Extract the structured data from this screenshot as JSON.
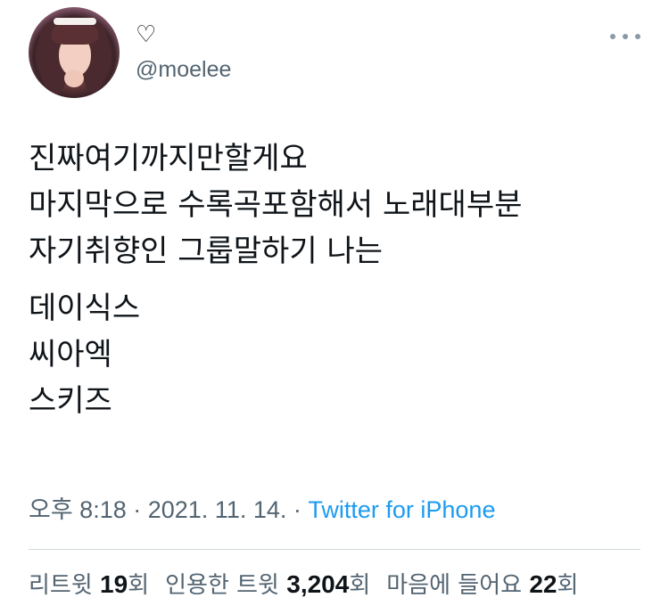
{
  "user": {
    "display_name": "♡",
    "handle": "@moelee"
  },
  "tweet": {
    "paragraphs": [
      [
        "진짜여기까지만할게요",
        "마지막으로 수록곡포함해서 노래대부분",
        "자기취향인 그룹말하기 나는"
      ],
      [
        "데이식스",
        "씨아엑",
        "스키즈"
      ]
    ]
  },
  "meta": {
    "time": "오후 8:18",
    "sep1": " · ",
    "date": "2021. 11. 14.",
    "sep2": " · ",
    "source": "Twitter for iPhone"
  },
  "stats": {
    "retweets": {
      "label": "리트윗 ",
      "count": "19",
      "unit": "회"
    },
    "quotes": {
      "label": "인용한 트윗 ",
      "count": "3,204",
      "unit": "회"
    },
    "likes": {
      "label": "마음에 들어요 ",
      "count": "22",
      "unit": "회"
    }
  },
  "icons": {
    "more": "more-options-icon"
  },
  "colors": {
    "link": "#1d9bf0",
    "secondary_text": "#536471",
    "primary_text": "#0f1419",
    "divider": "#cfd9de"
  }
}
